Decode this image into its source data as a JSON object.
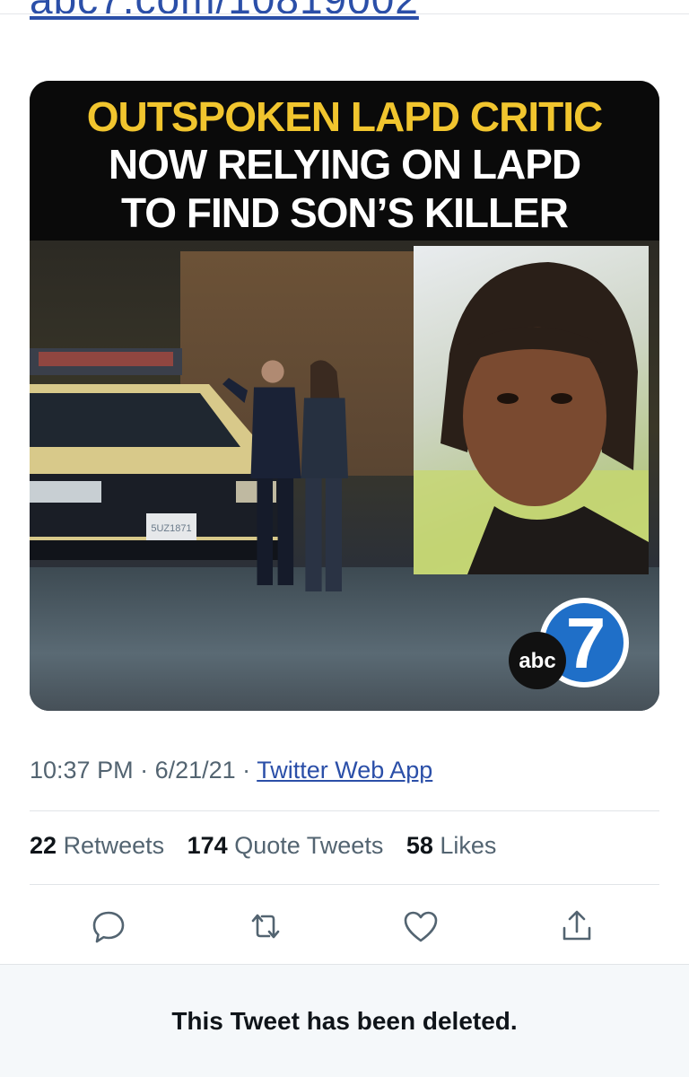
{
  "top_link": "abc7.com/10819002",
  "card": {
    "headline": [
      "OUTSPOKEN LAPD CRITIC",
      "NOW RELYING ON LAPD",
      "TO FIND SON’S KILLER"
    ],
    "logo_text": "abc",
    "logo_numeral": "7",
    "plate": "5UZ1871"
  },
  "meta": {
    "time": "10:37 PM",
    "sep1": " · ",
    "date": "6/21/21",
    "sep2": " · ",
    "source": "Twitter Web App"
  },
  "stats": {
    "retweets_count": "22",
    "retweets_label": "Retweets",
    "quotes_count": "174",
    "quotes_label": "Quote Tweets",
    "likes_count": "58",
    "likes_label": "Likes"
  },
  "actions": [
    "reply-icon",
    "retweet-icon",
    "like-icon",
    "share-icon"
  ],
  "deleted_notice": "This Tweet has been deleted.",
  "colors": {
    "link": "#2b4fa8",
    "muted": "#536471",
    "headline_yellow": "#f1c52e",
    "notice_bg": "#f5f8fa"
  }
}
